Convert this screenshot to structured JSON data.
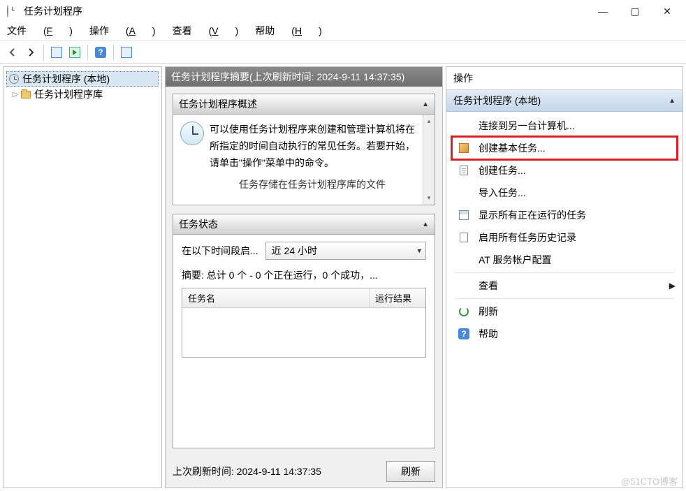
{
  "window": {
    "title": "任务计划程序"
  },
  "menu": {
    "file": "文件",
    "file_u": "F",
    "action": "操作",
    "action_u": "A",
    "view": "查看",
    "view_u": "V",
    "help": "帮助",
    "help_u": "H"
  },
  "tree": {
    "root": "任务计划程序 (本地)",
    "library": "任务计划程序库"
  },
  "center": {
    "header": "任务计划程序摘要(上次刷新时间: 2024-9-11 14:37:35)",
    "overview_title": "任务计划程序概述",
    "overview_text": "可以使用任务计划程序来创建和管理计算机将在所指定的时间自动执行的常见任务。若要开始，请单击\"操作\"菜单中的命令。",
    "overview_tail": "任务存储在任务计划程序库的文件",
    "status_title": "任务状态",
    "period_label": "在以下时间段启...",
    "period_value": "近 24 小时",
    "summary_line": "摘要: 总计 0 个 - 0 个正在运行，0 个成功，...",
    "col_name": "任务名",
    "col_result": "运行结果",
    "last_refresh": "上次刷新时间: 2024-9-11 14:37:35",
    "refresh_btn": "刷新"
  },
  "actions": {
    "header": "操作",
    "sub": "任务计划程序 (本地)",
    "items": [
      {
        "label": "连接到另一台计算机...",
        "icon": "none"
      },
      {
        "label": "创建基本任务...",
        "icon": "wand",
        "highlight": true
      },
      {
        "label": "创建任务...",
        "icon": "doc"
      },
      {
        "label": "导入任务...",
        "icon": "none"
      },
      {
        "label": "显示所有正在运行的任务",
        "icon": "table"
      },
      {
        "label": "启用所有任务历史记录",
        "icon": "hist"
      },
      {
        "label": "AT 服务帐户配置",
        "icon": "none"
      },
      {
        "label": "查看",
        "icon": "none",
        "chevron": true
      },
      {
        "label": "刷新",
        "icon": "refresh"
      },
      {
        "label": "帮助",
        "icon": "help"
      }
    ]
  },
  "watermark": "@51CTO博客"
}
